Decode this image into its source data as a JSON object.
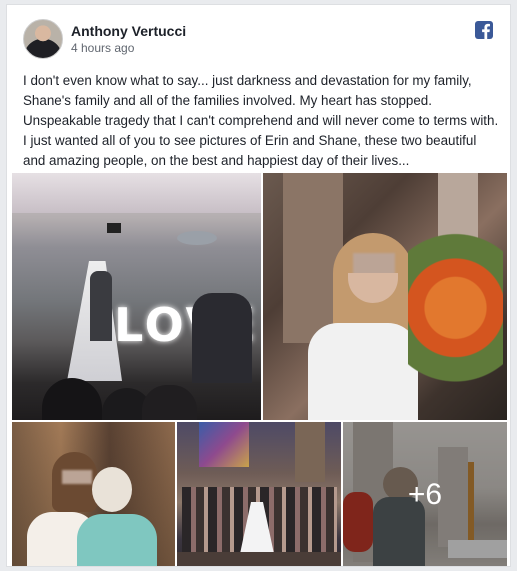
{
  "post": {
    "author": "Anthony Vertucci",
    "timestamp": "4 hours ago",
    "text": "I don't even know what to say... just darkness and devastation for my family, Shane's family and all of the families involved. My heart has stopped. Unspeakable tragedy that I can't comprehend and will never come to terms with. I just wanted all of you to see pictures of Erin and Shane, these two beautiful and amazing people, on the best and happiest day of their lives..."
  },
  "icons": {
    "platform": "facebook-icon"
  },
  "photos": {
    "love_sign_text": "LOVE",
    "more_count": "+6"
  },
  "colors": {
    "brand": "#3b5998",
    "text": "#1d2129",
    "meta": "#616770"
  }
}
